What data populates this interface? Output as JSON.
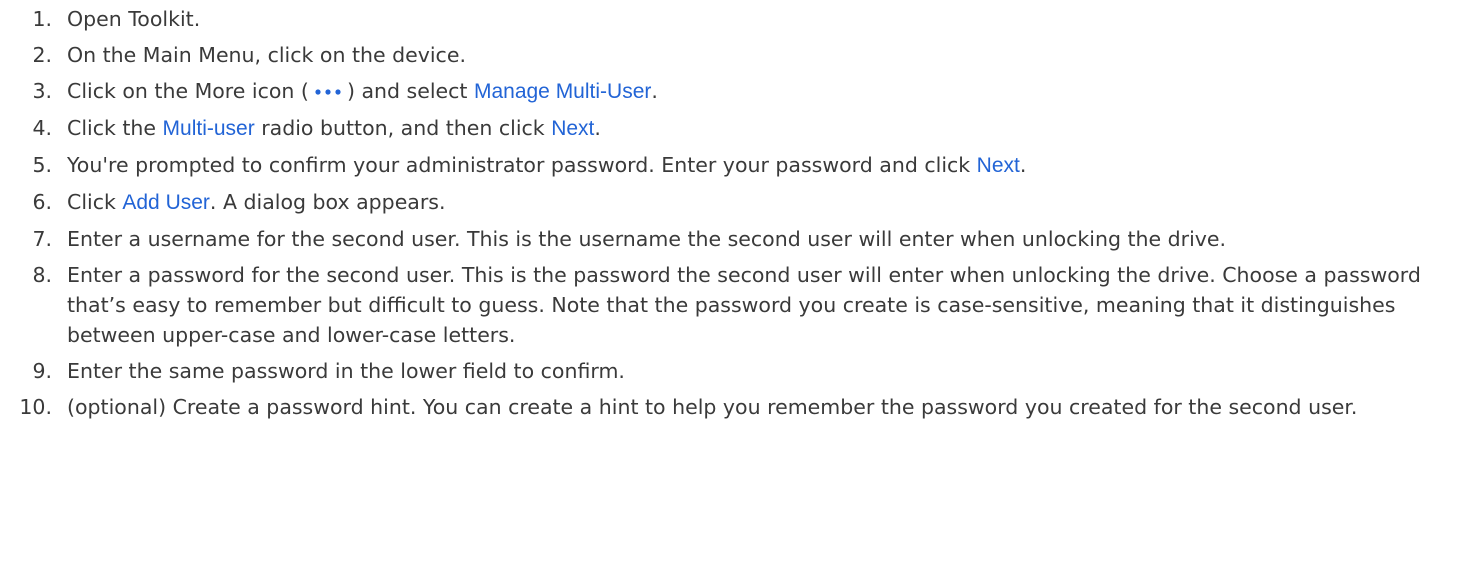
{
  "steps": [
    {
      "num": "1.",
      "parts": {
        "t1": "Open Toolkit."
      }
    },
    {
      "num": "2.",
      "parts": {
        "t1": "On the Main Menu, click on the device."
      }
    },
    {
      "num": "3.",
      "parts": {
        "t1": "Click on the More icon (",
        "icon": "more-icon",
        "t2": ") and select ",
        "link1": "Manage Multi-User",
        "t3": "."
      }
    },
    {
      "num": "4.",
      "parts": {
        "t1": "Click the ",
        "link1": "Multi-user",
        "t2": " radio button, and then click ",
        "link2": "Next",
        "t3": "."
      }
    },
    {
      "num": "5.",
      "parts": {
        "t1": "You're prompted to confirm your administrator password. Enter your password and click ",
        "link1": "Next",
        "t2": "."
      }
    },
    {
      "num": "6.",
      "parts": {
        "t1": "Click ",
        "link1": "Add User",
        "t2": ". A dialog box appears."
      }
    },
    {
      "num": "7.",
      "parts": {
        "t1": "Enter a username for the second user. This is the username the second user will enter when unlocking the drive."
      }
    },
    {
      "num": "8.",
      "parts": {
        "t1": "Enter a password for the second user. This is the password the second user will enter when unlocking the drive. Choose a password that’s easy to remember but difficult to guess. Note that the password you create is case-sensitive, meaning that it distinguishes between upper-case and lower-case letters."
      }
    },
    {
      "num": "9.",
      "parts": {
        "t1": "Enter the same password in the lower field to confirm."
      }
    },
    {
      "num": "10.",
      "parts": {
        "t1": "(optional) Create a password hint. You can create a hint to help you remember the password you created for the second user."
      }
    }
  ],
  "colors": {
    "text": "#3a3a3a",
    "link": "#2264d6",
    "icon_dots": "#2264d6"
  }
}
